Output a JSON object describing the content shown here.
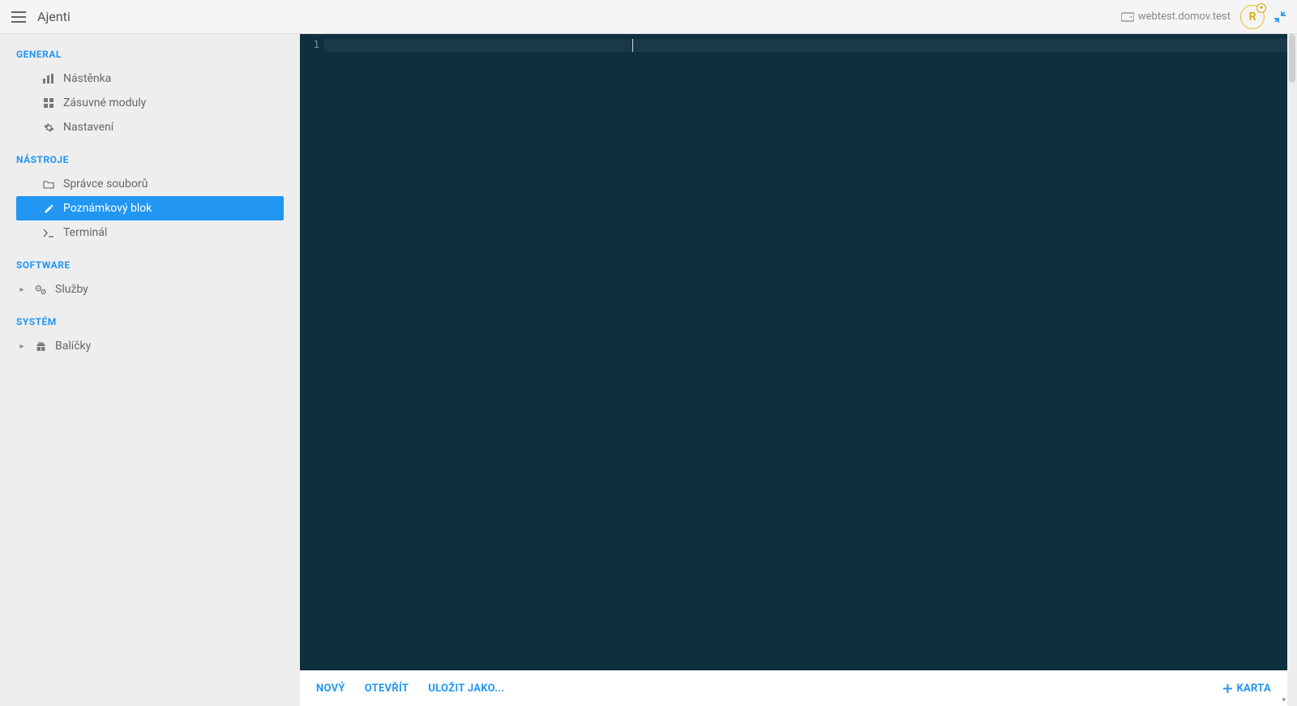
{
  "header": {
    "app_title": "Ajenti",
    "host_label": "webtest.domov.test",
    "user_initial": "R"
  },
  "sidebar": {
    "sections": [
      {
        "title": "GENERAL",
        "items": [
          {
            "label": "Nástěnka",
            "icon": "bar-chart-icon",
            "active": false,
            "expandable": false
          },
          {
            "label": "Zásuvné moduly",
            "icon": "grid-icon",
            "active": false,
            "expandable": false
          },
          {
            "label": "Nastavení",
            "icon": "gear-icon",
            "active": false,
            "expandable": false
          }
        ]
      },
      {
        "title": "NÁSTROJE",
        "items": [
          {
            "label": "Správce souborů",
            "icon": "folder-icon",
            "active": false,
            "expandable": false
          },
          {
            "label": "Poznámkový blok",
            "icon": "pencil-icon",
            "active": true,
            "expandable": false
          },
          {
            "label": "Terminál",
            "icon": "terminal-icon",
            "active": false,
            "expandable": false
          }
        ]
      },
      {
        "title": "SOFTWARE",
        "items": [
          {
            "label": "Služby",
            "icon": "cogs-icon",
            "active": false,
            "expandable": true
          }
        ]
      },
      {
        "title": "SYSTÉM",
        "items": [
          {
            "label": "Balíčky",
            "icon": "gift-icon",
            "active": false,
            "expandable": true
          }
        ]
      }
    ]
  },
  "editor": {
    "line_number_1": "1"
  },
  "bottom_bar": {
    "new_label": "NOVÝ",
    "open_label": "OTEVŘÍT",
    "save_as_label": "ULOŽIT JAKO...",
    "add_tab_label": "KARTA"
  }
}
